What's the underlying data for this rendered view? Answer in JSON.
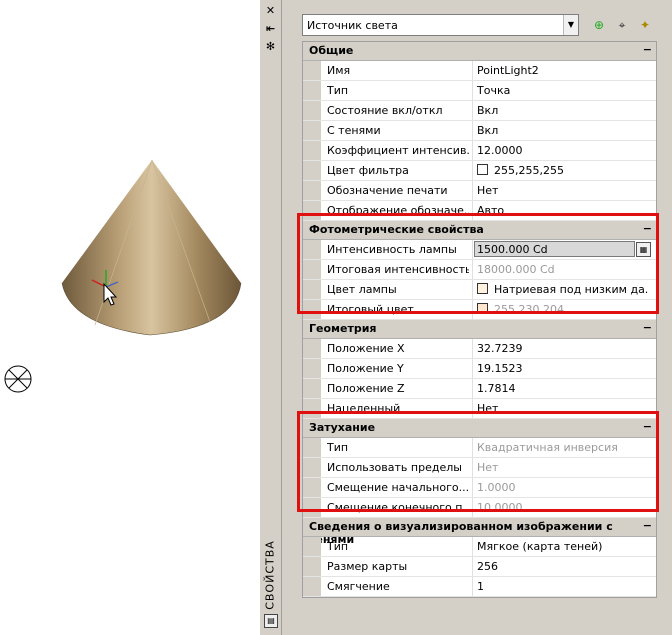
{
  "panel_title": "СВОЙСТВА",
  "selector": {
    "value": "Источник света"
  },
  "categories": [
    {
      "title": "Общие",
      "rows": [
        {
          "name": "Имя",
          "value": "PointLight2"
        },
        {
          "name": "Тип",
          "value": "Точка"
        },
        {
          "name": "Состояние вкл/откл",
          "value": "Вкл"
        },
        {
          "name": "С тенями",
          "value": "Вкл"
        },
        {
          "name": "Коэффициент интенсив...",
          "value": "12.0000"
        },
        {
          "name": "Цвет фильтра",
          "value": "255,255,255"
        },
        {
          "name": "Обозначение печати",
          "value": "Нет"
        },
        {
          "name": "Отображение обозначе...",
          "value": "Авто"
        }
      ]
    },
    {
      "title": "Фотометрические свойства",
      "rows": [
        {
          "name": "Интенсивность лампы",
          "value": "1500.000 Cd"
        },
        {
          "name": "Итоговая интенсивность",
          "value": "18000.000 Cd"
        },
        {
          "name": "Цвет лампы",
          "value": "Натриевая под низким да..."
        },
        {
          "name": "Итоговый цвет",
          "value": "255,230,204"
        }
      ]
    },
    {
      "title": "Геометрия",
      "rows": [
        {
          "name": "Положение X",
          "value": "32.7239"
        },
        {
          "name": "Положение Y",
          "value": "19.1523"
        },
        {
          "name": "Положение Z",
          "value": "1.7814"
        },
        {
          "name": "Нацеленный",
          "value": "Нет"
        }
      ]
    },
    {
      "title": "Затухание",
      "rows": [
        {
          "name": "Тип",
          "value": "Квадратичная инверсия"
        },
        {
          "name": "Использовать пределы",
          "value": "Нет"
        },
        {
          "name": "Смещение начального...",
          "value": "1.0000"
        },
        {
          "name": "Смещение конечного п...",
          "value": "10.0000"
        }
      ]
    },
    {
      "title": "Сведения о визуализированном изображении с тенями",
      "rows": [
        {
          "name": "Тип",
          "value": "Мягкое (карта теней)"
        },
        {
          "name": "Размер карты",
          "value": "256"
        },
        {
          "name": "Смягчение",
          "value": "1"
        }
      ]
    }
  ],
  "collapse_glyph": "−",
  "colors": {
    "highlight": "#e01010",
    "header_bg": "#d4d0c8",
    "readonly_text": "#9a9a9a"
  }
}
